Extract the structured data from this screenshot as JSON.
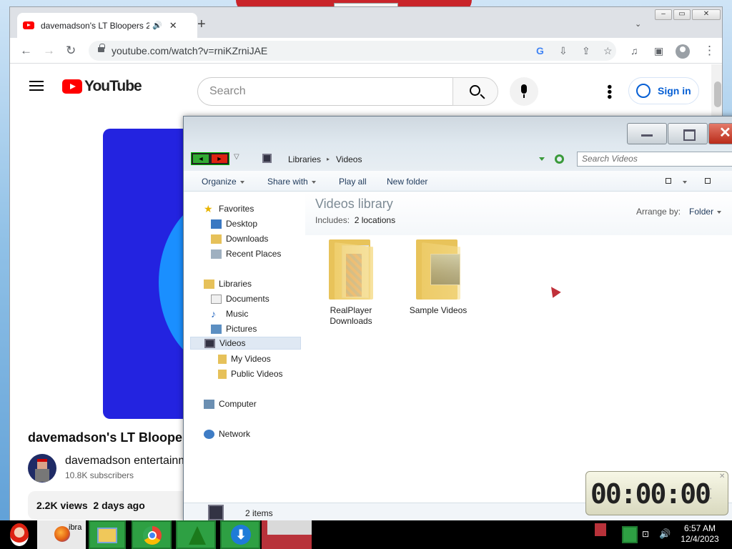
{
  "browser": {
    "tab_title": "davemadson's LT Bloopers 2",
    "tab_audio_icon": "speaker-icon",
    "url": "youtube.com/watch?v=rniKZrniJAE"
  },
  "youtube": {
    "logo_text": "YouTube",
    "search_placeholder": "Search",
    "sign_in": "Sign in",
    "video_title": "davemadson's LT Bloopers",
    "channel_name": "davemadson entertainm",
    "subscribers": "10.8K subscribers",
    "views": "2.2K views",
    "age": "2 days ago",
    "player_colors": {
      "outer": "#2323e0",
      "ring": "#1a8fff",
      "center": "#ffffff"
    }
  },
  "explorer": {
    "breadcrumb": [
      "Libraries",
      "Videos"
    ],
    "search_placeholder": "Search Videos",
    "commands": {
      "organize": "Organize",
      "share": "Share with",
      "play": "Play all",
      "newfolder": "New folder"
    },
    "nav": {
      "favorites": "Favorites",
      "desktop": "Desktop",
      "downloads": "Downloads",
      "recent": "Recent Places",
      "libraries": "Libraries",
      "documents": "Documents",
      "music": "Music",
      "pictures": "Pictures",
      "videos": "Videos",
      "myvideos": "My Videos",
      "publicvideos": "Public Videos",
      "computer": "Computer",
      "network": "Network"
    },
    "library_title": "Videos library",
    "includes_label": "Includes:",
    "includes_value": "2 locations",
    "arrange_label": "Arrange by:",
    "arrange_value": "Folder",
    "folders": [
      {
        "name": "RealPlayer Downloads"
      },
      {
        "name": "Sample Videos"
      }
    ],
    "status": "2 items"
  },
  "clock_widget": {
    "display": "00:00:00"
  },
  "taskbar": {
    "time": "6:57 AM",
    "date": "12/4/2023",
    "partial_label": "ibra"
  }
}
